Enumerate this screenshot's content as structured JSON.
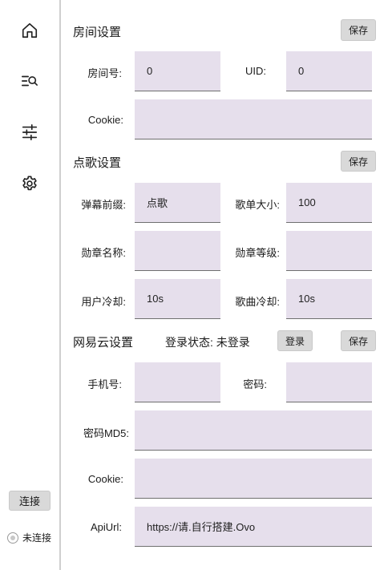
{
  "sidebar": {
    "icons": [
      "home-icon",
      "search-list-icon",
      "sliders-icon",
      "gear-icon"
    ],
    "connect_label": "连接",
    "status_label": "未连接"
  },
  "room": {
    "title": "房间设置",
    "save_label": "保存",
    "room_id_label": "房间号:",
    "room_id_value": "0",
    "uid_label": "UID:",
    "uid_value": "0",
    "cookie_label": "Cookie:",
    "cookie_value": ""
  },
  "song": {
    "title": "点歌设置",
    "save_label": "保存",
    "prefix_label": "弹幕前缀:",
    "prefix_value": "点歌",
    "playlist_size_label": "歌单大小:",
    "playlist_size_value": "100",
    "medal_name_label": "勋章名称:",
    "medal_name_value": "",
    "medal_level_label": "勋章等级:",
    "medal_level_value": "",
    "user_cooldown_label": "用户冷却:",
    "user_cooldown_value": "10s",
    "song_cooldown_label": "歌曲冷却:",
    "song_cooldown_value": "10s"
  },
  "netease": {
    "title": "网易云设置",
    "login_status": "登录状态: 未登录",
    "login_label": "登录",
    "save_label": "保存",
    "phone_label": "手机号:",
    "phone_value": "",
    "password_label": "密码:",
    "password_value": "",
    "password_md5_label": "密码MD5:",
    "password_md5_value": "",
    "cookie_label": "Cookie:",
    "cookie_value": "",
    "apiurl_label": "ApiUrl:",
    "apiurl_value": "https://请.自行搭建.Ovo"
  }
}
